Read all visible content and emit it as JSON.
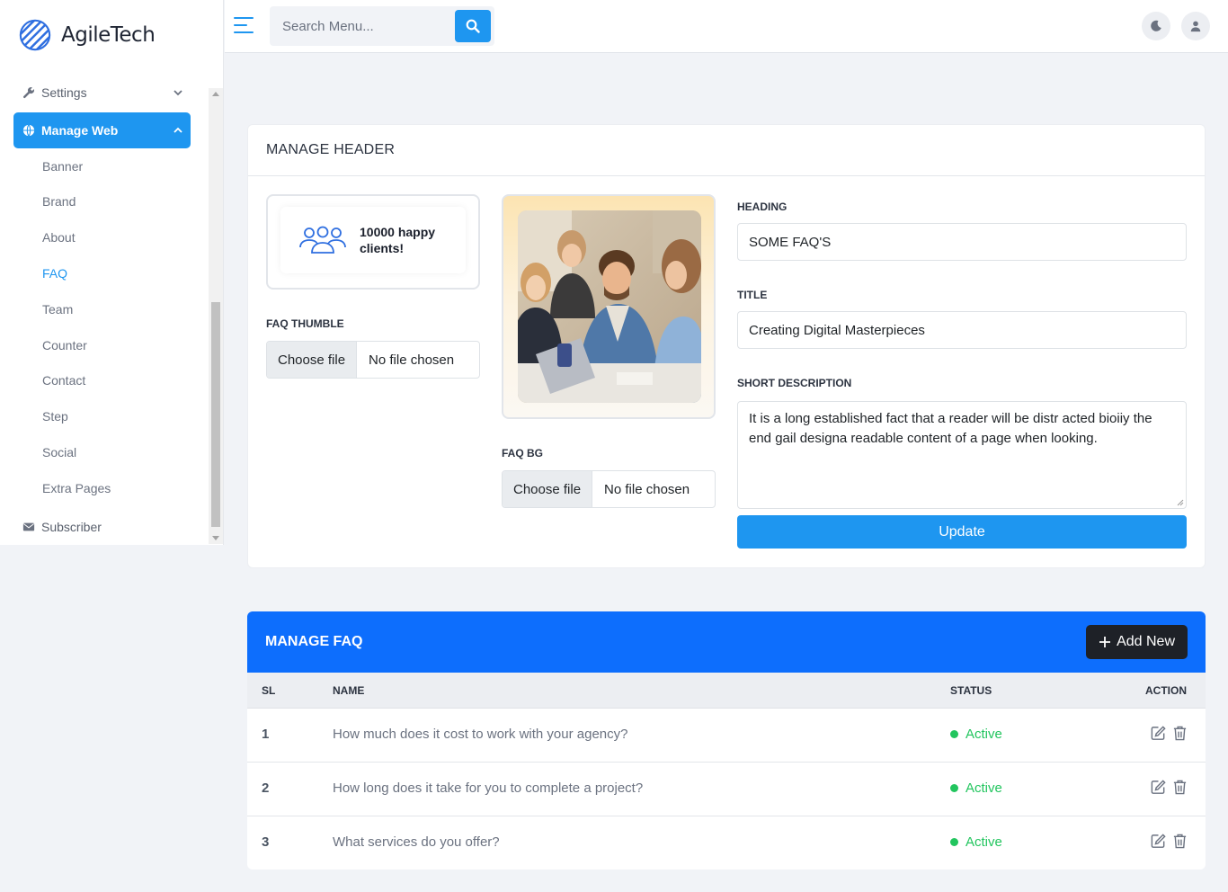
{
  "brand": {
    "name": "AgileTech"
  },
  "sidebar": {
    "settings_label": "Settings",
    "manage_web_label": "Manage Web",
    "sub_items": [
      "Banner",
      "Brand",
      "About",
      "FAQ",
      "Team",
      "Counter",
      "Contact",
      "Step",
      "Social",
      "Extra Pages"
    ],
    "current_item": "FAQ",
    "subscriber_label": "Subscriber"
  },
  "topbar": {
    "search_placeholder": "Search Menu..."
  },
  "manage_header": {
    "title": "MANAGE HEADER",
    "thumb_text_line1": "10000 happy",
    "thumb_text_line2": "clients!",
    "faq_thumble_label": "FAQ THUMBLE",
    "faq_bg_label": "FAQ BG",
    "choose_file": "Choose file",
    "no_file": "No file chosen",
    "heading_label": "HEADING",
    "heading_value": "SOME FAQ'S",
    "title_label": "TITLE",
    "title_value": "Creating Digital Masterpieces",
    "short_desc_label": "SHORT DESCRIPTION",
    "short_desc_value": "It is a long established fact that a reader will be distr acted bioiiy the end gail designa readable content of a page when looking.",
    "update_label": "Update"
  },
  "manage_faq": {
    "title": "MANAGE FAQ",
    "add_label": "Add New",
    "columns": {
      "sl": "SL",
      "name": "NAME",
      "status": "STATUS",
      "action": "ACTION"
    },
    "rows": [
      {
        "sl": "1",
        "name": "How much does it cost to work with your agency?",
        "status": "Active"
      },
      {
        "sl": "2",
        "name": "How long does it take for you to complete a project?",
        "status": "Active"
      },
      {
        "sl": "3",
        "name": "What services do you offer?",
        "status": "Active"
      }
    ]
  },
  "colors": {
    "primary": "#1e96f0",
    "faq_header": "#0d6efd",
    "status_active": "#22c55e",
    "dark_button": "#1e2127"
  }
}
